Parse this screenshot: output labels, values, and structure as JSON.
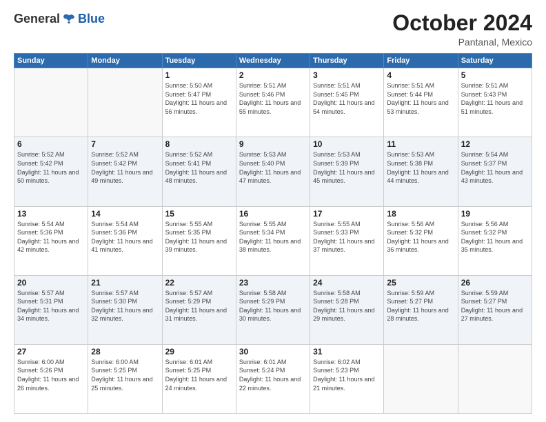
{
  "header": {
    "logo": {
      "general": "General",
      "blue": "Blue"
    },
    "title": "October 2024",
    "location": "Pantanal, Mexico"
  },
  "weekdays": [
    "Sunday",
    "Monday",
    "Tuesday",
    "Wednesday",
    "Thursday",
    "Friday",
    "Saturday"
  ],
  "weeks": [
    [
      {
        "day": "",
        "sunrise": "",
        "sunset": "",
        "daylight": ""
      },
      {
        "day": "",
        "sunrise": "",
        "sunset": "",
        "daylight": ""
      },
      {
        "day": "1",
        "sunrise": "Sunrise: 5:50 AM",
        "sunset": "Sunset: 5:47 PM",
        "daylight": "Daylight: 11 hours and 56 minutes."
      },
      {
        "day": "2",
        "sunrise": "Sunrise: 5:51 AM",
        "sunset": "Sunset: 5:46 PM",
        "daylight": "Daylight: 11 hours and 55 minutes."
      },
      {
        "day": "3",
        "sunrise": "Sunrise: 5:51 AM",
        "sunset": "Sunset: 5:45 PM",
        "daylight": "Daylight: 11 hours and 54 minutes."
      },
      {
        "day": "4",
        "sunrise": "Sunrise: 5:51 AM",
        "sunset": "Sunset: 5:44 PM",
        "daylight": "Daylight: 11 hours and 53 minutes."
      },
      {
        "day": "5",
        "sunrise": "Sunrise: 5:51 AM",
        "sunset": "Sunset: 5:43 PM",
        "daylight": "Daylight: 11 hours and 51 minutes."
      }
    ],
    [
      {
        "day": "6",
        "sunrise": "Sunrise: 5:52 AM",
        "sunset": "Sunset: 5:42 PM",
        "daylight": "Daylight: 11 hours and 50 minutes."
      },
      {
        "day": "7",
        "sunrise": "Sunrise: 5:52 AM",
        "sunset": "Sunset: 5:42 PM",
        "daylight": "Daylight: 11 hours and 49 minutes."
      },
      {
        "day": "8",
        "sunrise": "Sunrise: 5:52 AM",
        "sunset": "Sunset: 5:41 PM",
        "daylight": "Daylight: 11 hours and 48 minutes."
      },
      {
        "day": "9",
        "sunrise": "Sunrise: 5:53 AM",
        "sunset": "Sunset: 5:40 PM",
        "daylight": "Daylight: 11 hours and 47 minutes."
      },
      {
        "day": "10",
        "sunrise": "Sunrise: 5:53 AM",
        "sunset": "Sunset: 5:39 PM",
        "daylight": "Daylight: 11 hours and 45 minutes."
      },
      {
        "day": "11",
        "sunrise": "Sunrise: 5:53 AM",
        "sunset": "Sunset: 5:38 PM",
        "daylight": "Daylight: 11 hours and 44 minutes."
      },
      {
        "day": "12",
        "sunrise": "Sunrise: 5:54 AM",
        "sunset": "Sunset: 5:37 PM",
        "daylight": "Daylight: 11 hours and 43 minutes."
      }
    ],
    [
      {
        "day": "13",
        "sunrise": "Sunrise: 5:54 AM",
        "sunset": "Sunset: 5:36 PM",
        "daylight": "Daylight: 11 hours and 42 minutes."
      },
      {
        "day": "14",
        "sunrise": "Sunrise: 5:54 AM",
        "sunset": "Sunset: 5:36 PM",
        "daylight": "Daylight: 11 hours and 41 minutes."
      },
      {
        "day": "15",
        "sunrise": "Sunrise: 5:55 AM",
        "sunset": "Sunset: 5:35 PM",
        "daylight": "Daylight: 11 hours and 39 minutes."
      },
      {
        "day": "16",
        "sunrise": "Sunrise: 5:55 AM",
        "sunset": "Sunset: 5:34 PM",
        "daylight": "Daylight: 11 hours and 38 minutes."
      },
      {
        "day": "17",
        "sunrise": "Sunrise: 5:55 AM",
        "sunset": "Sunset: 5:33 PM",
        "daylight": "Daylight: 11 hours and 37 minutes."
      },
      {
        "day": "18",
        "sunrise": "Sunrise: 5:56 AM",
        "sunset": "Sunset: 5:32 PM",
        "daylight": "Daylight: 11 hours and 36 minutes."
      },
      {
        "day": "19",
        "sunrise": "Sunrise: 5:56 AM",
        "sunset": "Sunset: 5:32 PM",
        "daylight": "Daylight: 11 hours and 35 minutes."
      }
    ],
    [
      {
        "day": "20",
        "sunrise": "Sunrise: 5:57 AM",
        "sunset": "Sunset: 5:31 PM",
        "daylight": "Daylight: 11 hours and 34 minutes."
      },
      {
        "day": "21",
        "sunrise": "Sunrise: 5:57 AM",
        "sunset": "Sunset: 5:30 PM",
        "daylight": "Daylight: 11 hours and 32 minutes."
      },
      {
        "day": "22",
        "sunrise": "Sunrise: 5:57 AM",
        "sunset": "Sunset: 5:29 PM",
        "daylight": "Daylight: 11 hours and 31 minutes."
      },
      {
        "day": "23",
        "sunrise": "Sunrise: 5:58 AM",
        "sunset": "Sunset: 5:29 PM",
        "daylight": "Daylight: 11 hours and 30 minutes."
      },
      {
        "day": "24",
        "sunrise": "Sunrise: 5:58 AM",
        "sunset": "Sunset: 5:28 PM",
        "daylight": "Daylight: 11 hours and 29 minutes."
      },
      {
        "day": "25",
        "sunrise": "Sunrise: 5:59 AM",
        "sunset": "Sunset: 5:27 PM",
        "daylight": "Daylight: 11 hours and 28 minutes."
      },
      {
        "day": "26",
        "sunrise": "Sunrise: 5:59 AM",
        "sunset": "Sunset: 5:27 PM",
        "daylight": "Daylight: 11 hours and 27 minutes."
      }
    ],
    [
      {
        "day": "27",
        "sunrise": "Sunrise: 6:00 AM",
        "sunset": "Sunset: 5:26 PM",
        "daylight": "Daylight: 11 hours and 26 minutes."
      },
      {
        "day": "28",
        "sunrise": "Sunrise: 6:00 AM",
        "sunset": "Sunset: 5:25 PM",
        "daylight": "Daylight: 11 hours and 25 minutes."
      },
      {
        "day": "29",
        "sunrise": "Sunrise: 6:01 AM",
        "sunset": "Sunset: 5:25 PM",
        "daylight": "Daylight: 11 hours and 24 minutes."
      },
      {
        "day": "30",
        "sunrise": "Sunrise: 6:01 AM",
        "sunset": "Sunset: 5:24 PM",
        "daylight": "Daylight: 11 hours and 22 minutes."
      },
      {
        "day": "31",
        "sunrise": "Sunrise: 6:02 AM",
        "sunset": "Sunset: 5:23 PM",
        "daylight": "Daylight: 11 hours and 21 minutes."
      },
      {
        "day": "",
        "sunrise": "",
        "sunset": "",
        "daylight": ""
      },
      {
        "day": "",
        "sunrise": "",
        "sunset": "",
        "daylight": ""
      }
    ]
  ]
}
